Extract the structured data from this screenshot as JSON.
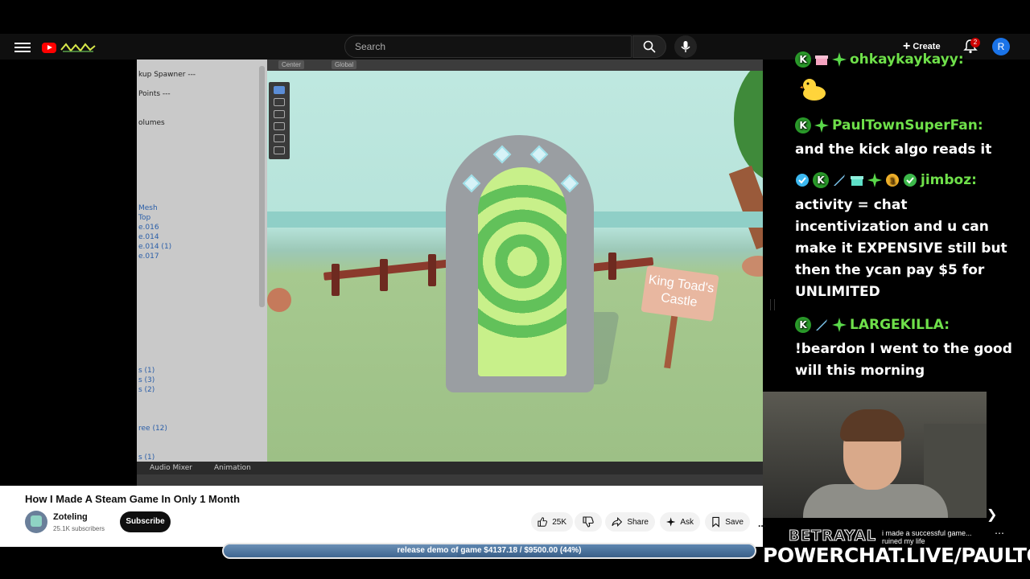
{
  "header": {
    "search_placeholder": "Search",
    "create_label": "Create",
    "notification_count": "2",
    "avatar_letter": "R"
  },
  "editor": {
    "hierarchy_items": [
      {
        "text": "kup Spawner ---",
        "blue": false
      },
      {
        "text": "Points ---",
        "blue": false
      },
      {
        "text": "olumes",
        "blue": false
      },
      {
        "text": "Mesh",
        "blue": true
      },
      {
        "text": "Top",
        "blue": true
      },
      {
        "text": "e.016",
        "blue": true
      },
      {
        "text": "e.014",
        "blue": true
      },
      {
        "text": "e.014 (1)",
        "blue": true
      },
      {
        "text": "e.017",
        "blue": true
      },
      {
        "text": "s (1)",
        "blue": true
      },
      {
        "text": "s (3)",
        "blue": true
      },
      {
        "text": "s (2)",
        "blue": true
      },
      {
        "text": "ree (12)",
        "blue": true
      },
      {
        "text": "s (1)",
        "blue": true
      }
    ],
    "toolbar": {
      "center": "Center",
      "global": "Global"
    },
    "tabs": {
      "audio_mixer": "Audio Mixer",
      "animation": "Animation"
    },
    "sign_text": "King Toad's Castle"
  },
  "video": {
    "title": "How I Made A Steam Game In Only 1 Month",
    "channel_name": "Zoteling",
    "subscribers": "25.1K subscribers",
    "subscribe_label": "Subscribe",
    "likes": "25K",
    "share_label": "Share",
    "ask_label": "Ask",
    "save_label": "Save",
    "more_label": "..."
  },
  "chat": [
    {
      "user": "ohkaykaykayy:",
      "message": ""
    },
    {
      "user": "PaulTownSuperFan:",
      "message": "and the kick algo reads it"
    },
    {
      "user": "jimboz:",
      "message": "activity = chat incentivization and u can make it EXPENSIVE still but then the ycan pay $5 for UNLIMITED"
    },
    {
      "user": "LARGEKILLA:",
      "message": "!beardon I went to the good will this morning"
    }
  ],
  "alert": {
    "title": "BETRAYAL",
    "text": "i made a successful game... ruined my life"
  },
  "goal": {
    "label": "release demo of game $4137.18 / $9500.00 (44%)",
    "progress": 0.44
  },
  "overlay": {
    "url": "POWERCHAT.LIVE/PAULTOWN"
  },
  "colors": {
    "youtube_red": "#ff0000",
    "chat_name_green": "#6fe04a",
    "goal_blue": "#3f6690"
  }
}
